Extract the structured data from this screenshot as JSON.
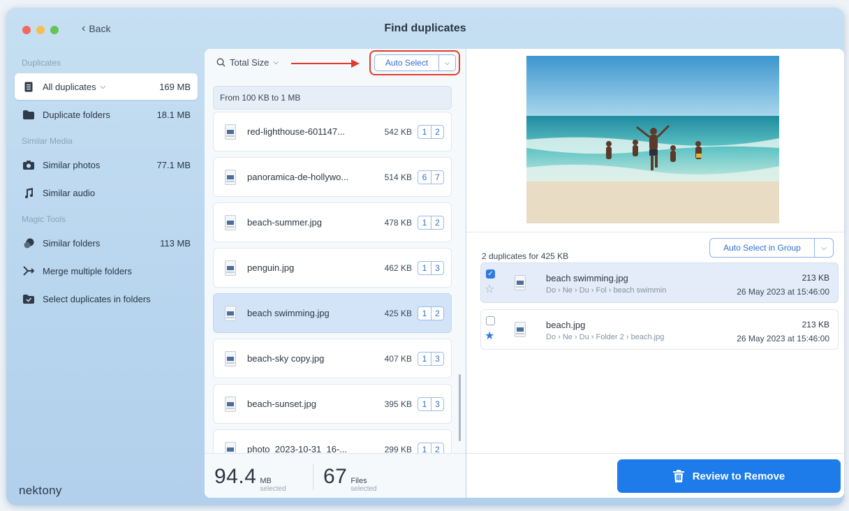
{
  "window": {
    "title": "Find duplicates",
    "back_label": "Back"
  },
  "sidebar": {
    "sections": {
      "duplicates": "Duplicates",
      "similar_media": "Similar Media",
      "magic_tools": "Magic Tools"
    },
    "items": [
      {
        "label": "All duplicates",
        "size": "169 MB",
        "icon": "document-icon",
        "active": true
      },
      {
        "label": "Duplicate folders",
        "size": "18.1 MB",
        "icon": "folder-icon"
      },
      {
        "label": "Similar photos",
        "size": "77.1 MB",
        "icon": "camera-icon"
      },
      {
        "label": "Similar audio",
        "size": "",
        "icon": "music-note-icon"
      },
      {
        "label": "Similar folders",
        "size": "113 MB",
        "icon": "similar-folders-icon"
      },
      {
        "label": "Merge multiple folders",
        "size": "",
        "icon": "merge-icon"
      },
      {
        "label": "Select duplicates in folders",
        "size": "",
        "icon": "check-folder-icon"
      }
    ],
    "brand": "nektony"
  },
  "list": {
    "sort_label": "Total Size",
    "auto_select_label": "Auto Select",
    "group_header": "From 100 KB to 1 MB",
    "rows": [
      {
        "name": "red-lighthouse-601147...",
        "size": "542 KB",
        "c1": "1",
        "c2": "2"
      },
      {
        "name": "panoramica-de-hollywo...",
        "size": "514 KB",
        "c1": "6",
        "c2": "7"
      },
      {
        "name": "beach-summer.jpg",
        "size": "478 KB",
        "c1": "1",
        "c2": "2"
      },
      {
        "name": "penguin.jpg",
        "size": "462 KB",
        "c1": "1",
        "c2": "3"
      },
      {
        "name": "beach swimming.jpg",
        "size": "425 KB",
        "c1": "1",
        "c2": "2"
      },
      {
        "name": "beach-sky copy.jpg",
        "size": "407 KB",
        "c1": "1",
        "c2": "3"
      },
      {
        "name": "beach-sunset.jpg",
        "size": "395 KB",
        "c1": "1",
        "c2": "3"
      },
      {
        "name": "photo_2023-10-31_16-...",
        "size": "299 KB",
        "c1": "1",
        "c2": "2"
      }
    ],
    "selected_index": 4
  },
  "footer": {
    "mb_value": "94.4",
    "mb_unit": "MB",
    "mb_caption": "selected",
    "files_value": "67",
    "files_unit": "Files",
    "files_caption": "selected"
  },
  "detail": {
    "dup_title": "2 duplicates for 425 KB",
    "auto_select_group_label": "Auto Select in Group",
    "items": [
      {
        "name": "beach swimming.jpg",
        "path": "Do › Ne › Du › Fol › beach swimmin",
        "size": "213 KB",
        "date": "26 May 2023 at 15:46:00",
        "checked": true,
        "starred": false
      },
      {
        "name": "beach.jpg",
        "path": "Do › Ne › Du › Folder 2 › beach.jpg",
        "size": "213 KB",
        "date": "26 May 2023 at 15:46:00",
        "checked": false,
        "starred": true
      }
    ],
    "review_label": "Review to Remove"
  },
  "colors": {
    "accent": "#1e7bea",
    "highlight": "#e23a2a",
    "selected_row": "#d3e3f8"
  }
}
